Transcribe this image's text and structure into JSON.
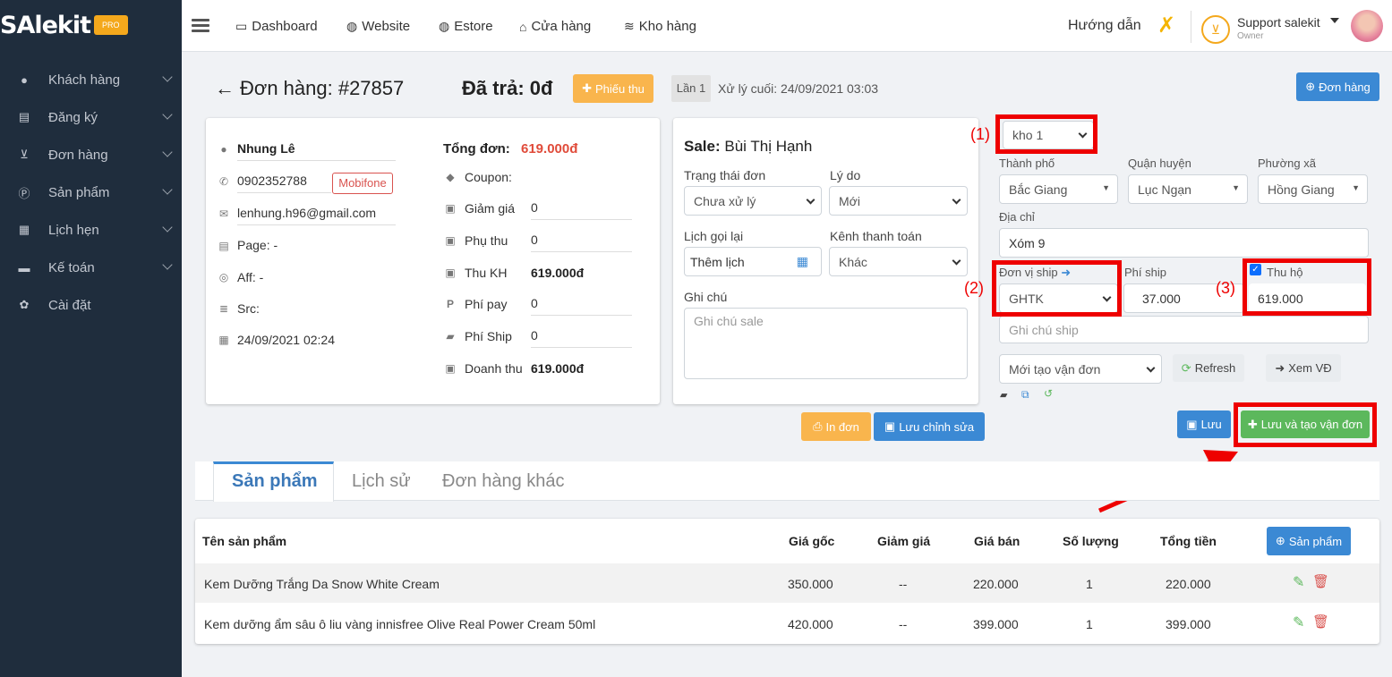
{
  "brand": {
    "logo": "SAlekit",
    "badge": "PRO"
  },
  "sidebar": {
    "items": [
      {
        "label": "Khách hàng",
        "icon": "user-icon"
      },
      {
        "label": "Đăng ký",
        "icon": "list-icon"
      },
      {
        "label": "Đơn hàng",
        "icon": "cart-icon"
      },
      {
        "label": "Sản phẩm",
        "icon": "product-icon"
      },
      {
        "label": "Lịch hẹn",
        "icon": "calendar-icon"
      },
      {
        "label": "Kế toán",
        "icon": "credit-card-icon"
      },
      {
        "label": "Cài đặt",
        "icon": "gear-icon"
      }
    ]
  },
  "topnav": {
    "items": [
      "Dashboard",
      "Website",
      "Estore",
      "Cửa hàng",
      "Kho hàng"
    ],
    "guide": "Hướng dẫn",
    "user_name": "Support salekit",
    "user_role": "Owner"
  },
  "order": {
    "title": "Đơn hàng: #27857",
    "paid": "Đã trả: 0đ",
    "receipt_btn": "Phiếu thu",
    "attempt": "Lần 1",
    "last_processed": "Xử lý cuối: 24/09/2021 03:03",
    "order_btn": "Đơn hàng"
  },
  "customer": {
    "name": "Nhung Lê",
    "phone": "0902352788",
    "carrier": "Mobifone",
    "email": "lenhung.h96@gmail.com",
    "page": "Page: -",
    "aff": "Aff: -",
    "src": "Src:",
    "date": "24/09/2021 02:24"
  },
  "totals": {
    "total_label": "Tổng đơn:",
    "total_value": "619.000đ",
    "coupon_label": "Coupon:",
    "discount_label": "Giảm giá",
    "discount_value": "0",
    "extra_label": "Phụ thu",
    "extra_value": "0",
    "paid_label": "Thu KH",
    "paid_value": "619.000đ",
    "payfee_label": "Phí pay",
    "payfee_value": "0",
    "ship_label": "Phí Ship",
    "ship_value": "0",
    "revenue_label": "Doanh thu",
    "revenue_value": "619.000đ"
  },
  "sale": {
    "label": "Sale:",
    "name": "Bùi Thị Hạnh",
    "status_label": "Trạng thái đơn",
    "status_value": "Chưa xử lý",
    "reason_label": "Lý do",
    "reason_value": "Mới",
    "callback_label": "Lịch gọi lại",
    "callback_value": "Thêm lịch",
    "channel_label": "Kênh thanh toán",
    "channel_value": "Khác",
    "note_label": "Ghi chú",
    "note_placeholder": "Ghi chú sale",
    "print_btn": "In đơn",
    "save_edit_btn": "Lưu chỉnh sửa"
  },
  "shipping": {
    "warehouse": "kho 1",
    "city_label": "Thành phố",
    "city_value": "Bắc Giang",
    "district_label": "Quận huyện",
    "district_value": "Lục Ngạn",
    "ward_label": "Phường xã",
    "ward_value": "Hồng Giang",
    "address_label": "Địa chỉ",
    "address_value": "Xóm 9",
    "carrier_label": "Đơn vị ship",
    "carrier_value": "GHTK",
    "fee_label": "Phí ship",
    "fee_value": "37.000",
    "cod_label": "Thu hộ",
    "cod_value": "619.000",
    "ship_note_placeholder": "Ghi chú ship",
    "waybill_status": "Mới tạo vận đơn",
    "refresh_btn": "Refresh",
    "view_btn": "Xem VĐ",
    "save_btn": "Lưu",
    "save_create_btn": "Lưu và tạo vận đơn"
  },
  "annotations": {
    "a1": "(1)",
    "a2": "(2)",
    "a3": "(3)"
  },
  "tabs": [
    "Sản phẩm",
    "Lịch sử",
    "Đơn hàng khác"
  ],
  "products": {
    "headers": [
      "Tên sản phẩm",
      "Giá gốc",
      "Giảm giá",
      "Giá bán",
      "Số lượng",
      "Tổng tiền"
    ],
    "add_btn": "Sản phẩm",
    "rows": [
      [
        "Kem Dưỡng Trắng Da Snow White Cream",
        "350.000",
        "--",
        "220.000",
        "1",
        "220.000"
      ],
      [
        "Kem dưỡng ẩm sâu ô liu vàng innisfree Olive Real Power Cream 50ml",
        "420.000",
        "--",
        "399.000",
        "1",
        "399.000"
      ]
    ]
  },
  "colors": {
    "sidebar": "#1f2d3d",
    "accent_blue": "#3b89d4",
    "highlight_red": "#e00000",
    "total_red": "#e04b3a"
  }
}
